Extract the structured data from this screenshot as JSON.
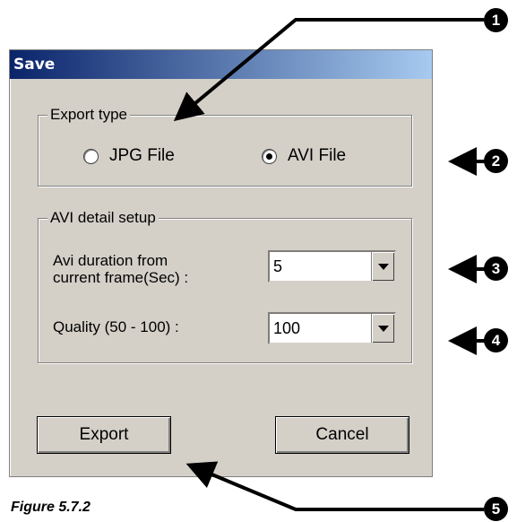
{
  "dialog": {
    "title": "Save",
    "export_type": {
      "legend": "Export type",
      "options": [
        {
          "label": "JPG File",
          "selected": false
        },
        {
          "label": "AVI File",
          "selected": true
        }
      ]
    },
    "avi_setup": {
      "legend": "AVI detail setup",
      "duration_label_line1": "Avi duration from",
      "duration_label_line2": "current frame(Sec) :",
      "duration_value": "5",
      "quality_label": "Quality (50 - 100) :",
      "quality_value": "100"
    },
    "buttons": {
      "export": "Export",
      "cancel": "Cancel"
    }
  },
  "caption": "Figure 5.7.2",
  "callouts": [
    "1",
    "2",
    "3",
    "4",
    "5"
  ]
}
